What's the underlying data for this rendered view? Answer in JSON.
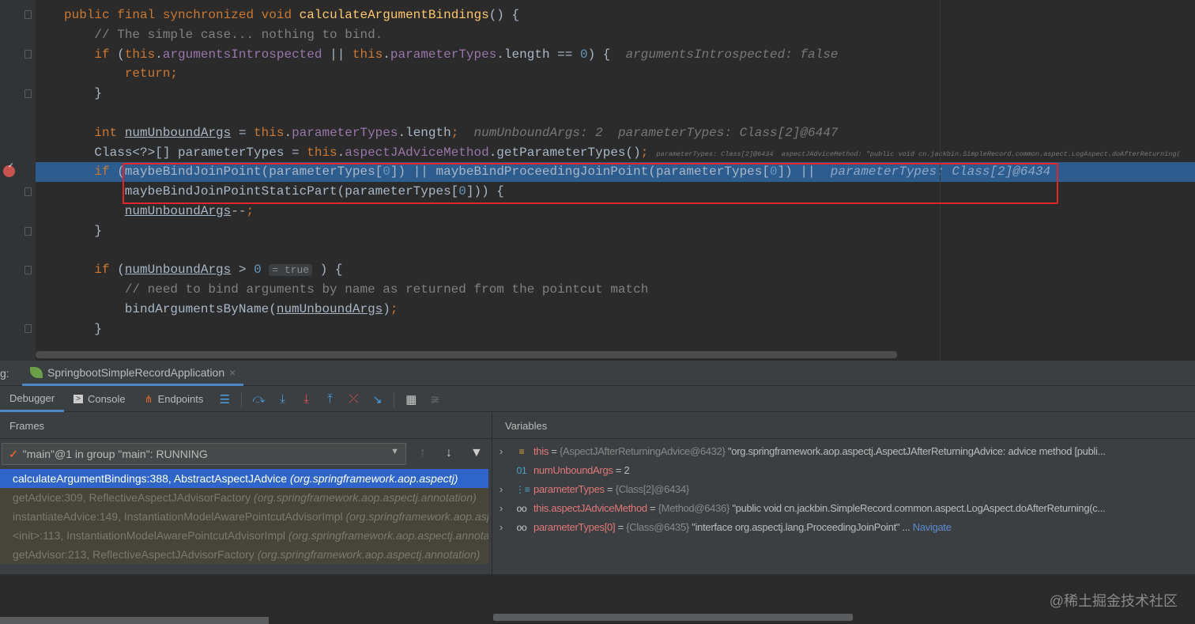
{
  "editor": {
    "lines": [
      [
        [
          "public final synchronized void ",
          "kw"
        ],
        [
          "calculateArgumentBindings",
          "fn"
        ],
        [
          "() {",
          ""
        ]
      ],
      [
        [
          "    // The simple case... nothing to bind.",
          "cm"
        ]
      ],
      [
        [
          "    if ",
          "kw"
        ],
        [
          "(",
          ""
        ],
        [
          "this",
          "kw"
        ],
        [
          ".",
          ""
        ],
        [
          "argumentsIntrospected",
          "fd"
        ],
        [
          " || ",
          ""
        ],
        [
          "this",
          "kw"
        ],
        [
          ".",
          ""
        ],
        [
          "parameterTypes",
          "fd"
        ],
        [
          ".length == ",
          ""
        ],
        [
          "0",
          "nm"
        ],
        [
          ") {  ",
          ""
        ],
        [
          "argumentsIntrospected: false",
          "hint"
        ]
      ],
      [
        [
          "        return;",
          "kw"
        ]
      ],
      [
        [
          "    }",
          ""
        ]
      ],
      [],
      [
        [
          "    int ",
          "kw"
        ],
        [
          "numUnboundArgs",
          "ul"
        ],
        [
          " = ",
          ""
        ],
        [
          "this",
          "kw"
        ],
        [
          ".",
          ""
        ],
        [
          "parameterTypes",
          "fd"
        ],
        [
          ".length",
          ""
        ],
        [
          ";",
          "kw"
        ],
        [
          "  numUnboundArgs: 2  parameterTypes: Class[2]@6447",
          "hint"
        ]
      ],
      [
        [
          "    Class<?>[] parameterTypes = ",
          ""
        ],
        [
          "this",
          "kw"
        ],
        [
          ".",
          ""
        ],
        [
          "aspectJAdviceMethod",
          "fd"
        ],
        [
          ".getParameterTypes()",
          ""
        ],
        [
          ";",
          "kw"
        ],
        [
          "  parameterTypes: Class[2]@6434  aspectJAdviceMethod: \"public void cn.jackbin.SimpleRecord.common.aspect.LogAspect.doAfterReturning(",
          "hint"
        ]
      ],
      [
        [
          "    if ",
          "kw"
        ],
        [
          "(maybeBindJoinPoint(parameterTypes[",
          ""
        ],
        [
          "0",
          "nm"
        ],
        [
          "]) || maybeBindProceedingJoinPoint(parameterTypes[",
          ""
        ],
        [
          "0",
          "nm"
        ],
        [
          "]) ||  ",
          ""
        ],
        [
          "parameterTypes: Class[2]@6434",
          "hint"
        ]
      ],
      [
        [
          "        maybeBindJoinPointStaticPart(parameterTypes[",
          ""
        ],
        [
          "0",
          "nm"
        ],
        [
          "])) {",
          ""
        ]
      ],
      [
        [
          "        ",
          ""
        ],
        [
          "numUnboundArgs",
          "ul"
        ],
        [
          "--",
          ""
        ],
        [
          ";",
          "kw"
        ]
      ],
      [
        [
          "    }",
          ""
        ]
      ],
      [],
      [
        [
          "    if ",
          "kw"
        ],
        [
          "(",
          ""
        ],
        [
          "numUnboundArgs",
          "ul"
        ],
        [
          " > ",
          ""
        ],
        [
          "0",
          "nm"
        ],
        [
          " ",
          ""
        ],
        [
          "= true",
          "badge"
        ],
        [
          " ) {",
          ""
        ]
      ],
      [
        [
          "        // need to bind arguments by name as returned from the pointcut match",
          "cm"
        ]
      ],
      [
        [
          "        bindArgumentsByName(",
          ""
        ],
        [
          "numUnboundArgs",
          "ul"
        ],
        [
          ")",
          ""
        ],
        [
          ";",
          "kw"
        ]
      ],
      [
        [
          "    }",
          ""
        ]
      ]
    ]
  },
  "debug": {
    "label": "g:",
    "run_config": "SpringbootSimpleRecordApplication",
    "close": "×",
    "tabs": [
      "Debugger",
      "Console",
      "Endpoints"
    ],
    "frames_title": "Frames",
    "thread": "\"main\"@1 in group \"main\": RUNNING",
    "frames": [
      {
        "method": "calculateArgumentBindings:388, AbstractAspectJAdvice",
        "pkg": "(org.springframework.aop.aspectj)"
      },
      {
        "method": "getAdvice:309, ReflectiveAspectJAdvisorFactory",
        "pkg": "(org.springframework.aop.aspectj.annotation)"
      },
      {
        "method": "instantiateAdvice:149, InstantiationModelAwarePointcutAdvisorImpl",
        "pkg": "(org.springframework.aop.aspectj.annotation)"
      },
      {
        "method": "<init>:113, InstantiationModelAwarePointcutAdvisorImpl",
        "pkg": "(org.springframework.aop.aspectj.annotation)"
      },
      {
        "method": "getAdvisor:213, ReflectiveAspectJAdvisorFactory",
        "pkg": "(org.springframework.aop.aspectj.annotation)"
      }
    ],
    "variables_title": "Variables",
    "variables": [
      {
        "name": "this",
        "type": "{AspectJAfterReturningAdvice@6432}",
        "value": "\"org.springframework.aop.aspectj.AspectJAfterReturningAdvice: advice method [publi...",
        "icon": "field-icon",
        "expandable": true
      },
      {
        "name": "numUnboundArgs",
        "type": "",
        "value": "2",
        "icon": "primitive-icon",
        "expandable": false
      },
      {
        "name": "parameterTypes",
        "type": "{Class[2]@6434}",
        "value": "",
        "icon": "array-icon",
        "expandable": true
      },
      {
        "name": "this.aspectJAdviceMethod",
        "type": "{Method@6436}",
        "value": "\"public void cn.jackbin.SimpleRecord.common.aspect.LogAspect.doAfterReturning(c...",
        "icon": "watch-icon",
        "expandable": true
      },
      {
        "name": "parameterTypes[0]",
        "type": "{Class@6435}",
        "value": "\"interface org.aspectj.lang.ProceedingJoinPoint\" ...",
        "icon": "watch-icon",
        "expandable": true,
        "link": "Navigate"
      }
    ],
    "watermark": "@稀土掘金技术社区"
  }
}
